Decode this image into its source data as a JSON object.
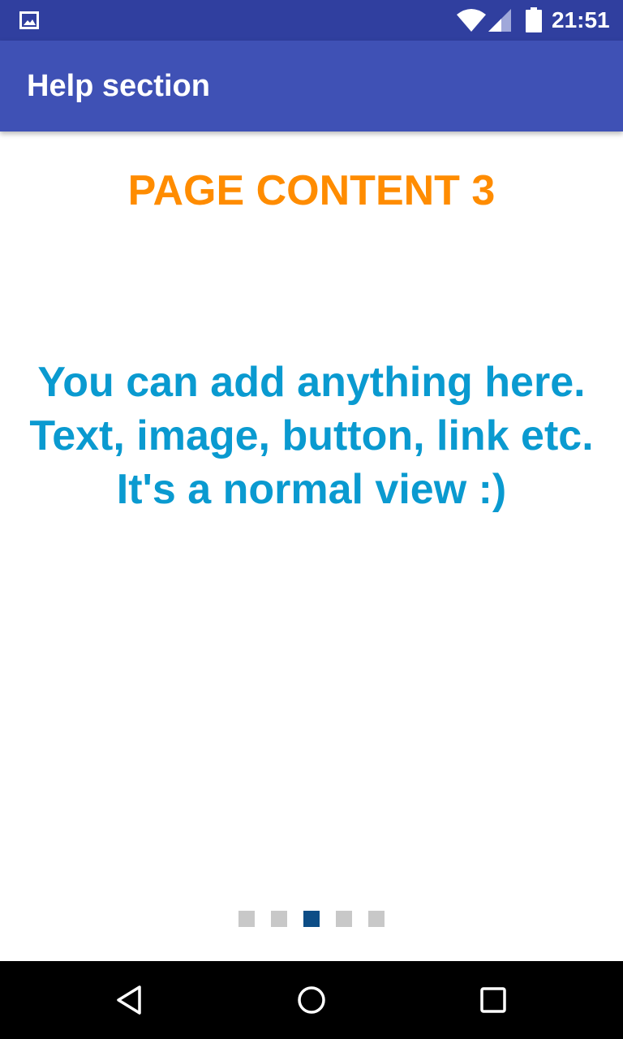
{
  "status_bar": {
    "time": "21:51",
    "icons": [
      "gallery-icon",
      "wifi-icon",
      "signal-icon",
      "battery-icon"
    ],
    "background_color": "#303f9f"
  },
  "app_bar": {
    "title": "Help section",
    "background_color": "#3f51b5"
  },
  "content": {
    "heading": "PAGE CONTENT 3",
    "heading_color": "#ff8c00",
    "body": "You can add anything here. Text, image, button, link etc. It's a normal view :)",
    "body_color": "#0a9ad0"
  },
  "page_indicator": {
    "total_pages": 5,
    "current_page": 3,
    "active_color": "#0d4d86",
    "inactive_color": "#c8c8c8"
  },
  "nav_bar": {
    "icons": [
      "back-icon",
      "home-icon",
      "recents-icon"
    ]
  }
}
